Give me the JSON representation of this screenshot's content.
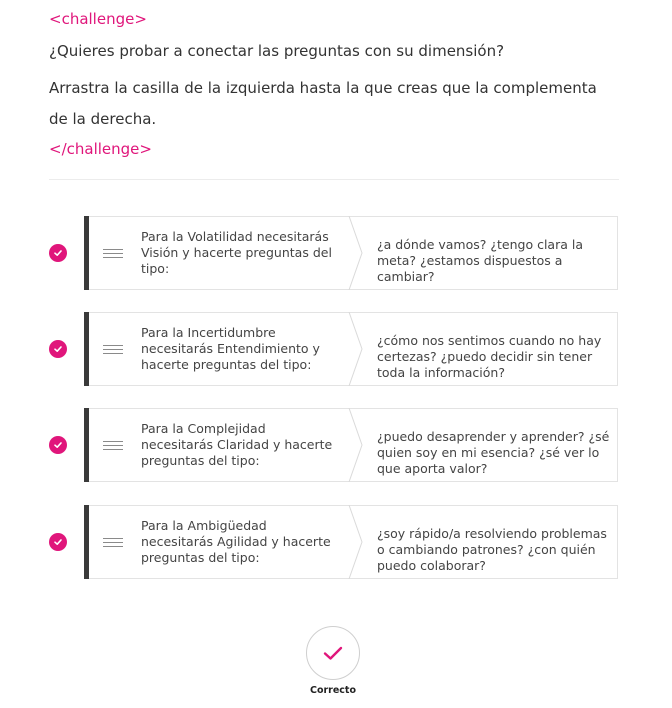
{
  "challenge": {
    "open_tag": "<challenge>",
    "question": "¿Quieres probar a conectar las preguntas con su dimensión?",
    "instruction": "Arrastra la casilla de la izquierda hasta la que creas que la complementa de la derecha.",
    "close_tag": "</challenge>"
  },
  "pairs": [
    {
      "left": "Para la Volatilidad necesitarás Visión y hacerte preguntas del tipo:",
      "right": "¿a dónde vamos? ¿tengo clara la meta? ¿estamos dispuestos a cambiar?",
      "status": "correct"
    },
    {
      "left": "Para la Incertidumbre necesitarás Entendimiento y hacerte preguntas del tipo:",
      "right": "¿cómo nos sentimos cuando no hay certezas? ¿puedo decidir sin tener toda la información?",
      "status": "correct"
    },
    {
      "left": "Para la Complejidad necesitarás Claridad y hacerte preguntas del tipo:",
      "right": "¿puedo desaprender y aprender? ¿sé quien soy en mi esencia? ¿sé ver lo que aporta valor?",
      "status": "correct"
    },
    {
      "left": "Para la Ambigüedad necesitarás Agilidad y hacerte preguntas del tipo:",
      "right": "¿soy rápido/a resolviendo problemas o cambiando patrones? ¿con quién puedo colaborar?",
      "status": "correct"
    }
  ],
  "result": {
    "label": "Correcto",
    "icon": "check-icon"
  },
  "colors": {
    "accent": "#e0167b",
    "bar": "#3a3a3a",
    "border": "#e3e3e3"
  }
}
